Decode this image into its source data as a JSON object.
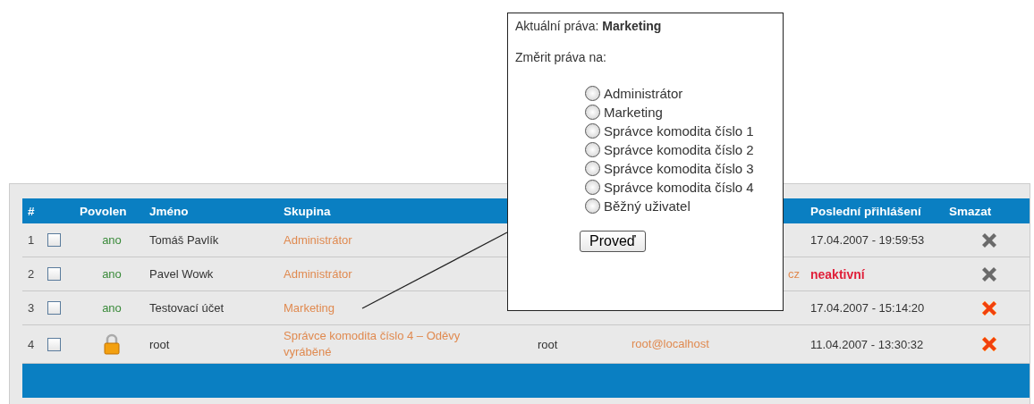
{
  "table": {
    "columns": [
      "#",
      "",
      "Povolen",
      "Jméno",
      "Skupina",
      "",
      "",
      "Poslední přihlášení",
      "Smazat"
    ],
    "rows": [
      {
        "number": "1",
        "checked": false,
        "enabled": {
          "kind": "text",
          "text": "ano"
        },
        "name": "Tomáš Pavlík",
        "group": "Administrátor",
        "login": "",
        "email": "",
        "last_login": "17.04.2007 - 19:59:53",
        "inactive": false,
        "delete_disabled": true
      },
      {
        "number": "2",
        "checked": false,
        "enabled": {
          "kind": "text",
          "text": "ano"
        },
        "name": "Pavel Wowk",
        "group": "Administrátor",
        "login": "",
        "email": "cz",
        "last_login": "neaktivní",
        "inactive": true,
        "delete_disabled": true
      },
      {
        "number": "3",
        "checked": false,
        "enabled": {
          "kind": "text",
          "text": "ano"
        },
        "name": "Testovací účet",
        "group": "Marketing",
        "login": "",
        "email": "",
        "last_login": "17.04.2007 - 15:14:20",
        "inactive": false,
        "delete_disabled": false
      },
      {
        "number": "4",
        "checked": false,
        "enabled": {
          "kind": "lock"
        },
        "name": "root",
        "group": "Správce komodita číslo 4 – Oděvy vyráběné",
        "login": "root",
        "email": "root@localhost",
        "last_login": "11.04.2007 - 13:30:32",
        "inactive": false,
        "delete_disabled": false
      }
    ]
  },
  "popup": {
    "current": "Aktuální práva: **Marketing**",
    "change_label": "Změrit práva na:",
    "options": [
      {
        "label": "Administrátor",
        "selected": false
      },
      {
        "label": "Marketing",
        "selected": false
      },
      {
        "label": "Správce komodita číslo 1",
        "selected": false
      },
      {
        "label": "Správce komodita číslo 2",
        "selected": false
      },
      {
        "label": "Správce komodita číslo 3",
        "selected": false
      },
      {
        "label": "Správce komodita číslo 4",
        "selected": false
      },
      {
        "label": "Běžný uživatel",
        "selected": false
      }
    ],
    "button": "Proveď"
  }
}
